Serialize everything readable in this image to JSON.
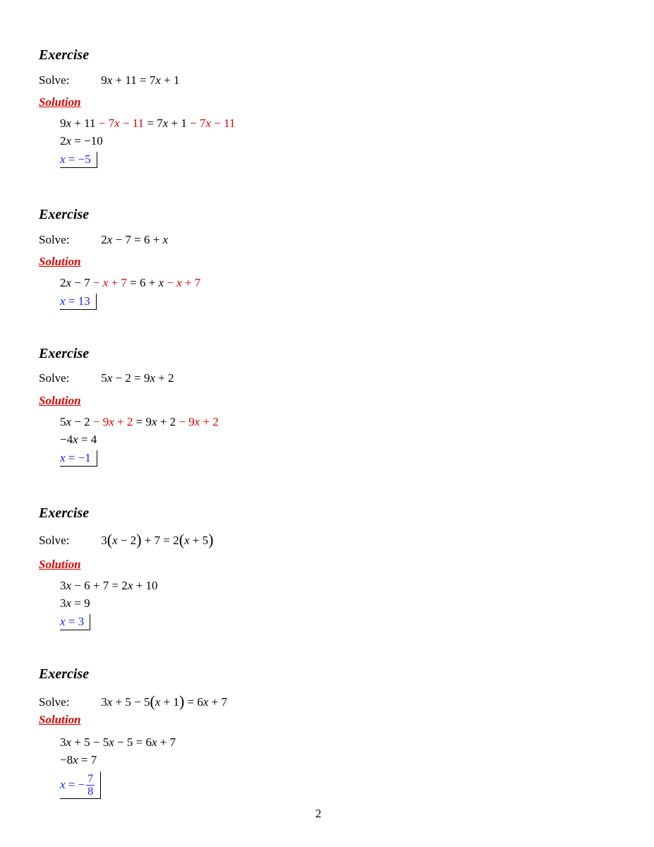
{
  "labels": {
    "exercise": "Exercise",
    "solve": "Solve:",
    "solution": "Solution"
  },
  "exercises": [
    {
      "problem": "9x + 11 = 7x + 1",
      "steps": [
        "9x + 11 − 7x − 11 = 7x + 1 − 7x − 11",
        "2x = −10"
      ],
      "answer": "x = −5"
    },
    {
      "problem": "2x − 7 = 6 + x",
      "steps": [
        "2x − 7 − x + 7 = 6 + x − x + 7"
      ],
      "answer": "x = 13"
    },
    {
      "problem": "5x − 2 = 9x + 2",
      "steps": [
        "5x − 2 − 9x + 2 = 9x + 2 − 9x + 2",
        "−4x = 4"
      ],
      "answer": "x = −1"
    },
    {
      "problem": "3(x − 2) + 7 = 2(x + 5)",
      "steps": [
        "3x − 6 + 7 = 2x + 10",
        "3x = 9"
      ],
      "answer": "x = 3"
    },
    {
      "problem": "3x + 5 − 5(x + 1) = 6x + 7",
      "steps": [
        "3x + 5 − 5x − 5 = 6x + 7",
        "−8x = 7"
      ],
      "answer": "x = −7/8",
      "answer_fraction": {
        "numerator": "7",
        "denominator": "8"
      }
    }
  ],
  "page_number": "2",
  "colors": {
    "solution_label": "#e00000",
    "highlight": "#e00000",
    "answer": "#1a1aff"
  }
}
